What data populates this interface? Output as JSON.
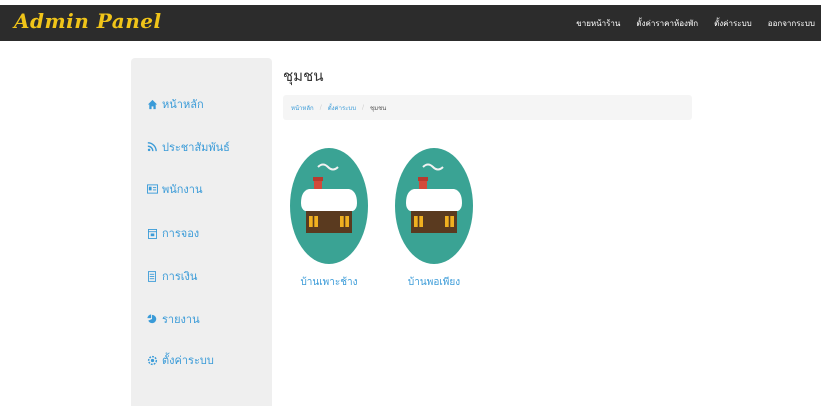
{
  "brand": "Admin Panel",
  "topnav": [
    "ขายหน้าร้าน",
    "ตั้งค่าราคาห้องพัก",
    "ตั้งค่าระบบ",
    "ออกจากระบบ"
  ],
  "sidebar": {
    "items": [
      {
        "label": "หน้าหลัก",
        "icon": "home-icon"
      },
      {
        "label": "ประชาสัมพันธ์",
        "icon": "rss-icon"
      },
      {
        "label": "พนักงาน",
        "icon": "id-card-icon"
      },
      {
        "label": "การจอง",
        "icon": "calendar-icon"
      },
      {
        "label": "การเงิน",
        "icon": "document-icon"
      },
      {
        "label": "รายงาน",
        "icon": "chart-icon"
      },
      {
        "label": "ตั้งค่าระบบ",
        "icon": "gear-icon"
      }
    ]
  },
  "main": {
    "title": "ชุมชน",
    "breadcrumb": [
      "หน้าหลัก",
      "ตั้งค่าระบบ",
      "ชุมชน"
    ],
    "communities": [
      {
        "name": "บ้านเพาะช้าง",
        "icon": "house-icon"
      },
      {
        "name": "บ้านพอเพียง",
        "icon": "house-icon"
      }
    ]
  },
  "colors": {
    "accent": "#3a9bd8",
    "brand": "#f0c419",
    "topbar": "#2c2c2c",
    "house_circle": "#3aa394"
  }
}
